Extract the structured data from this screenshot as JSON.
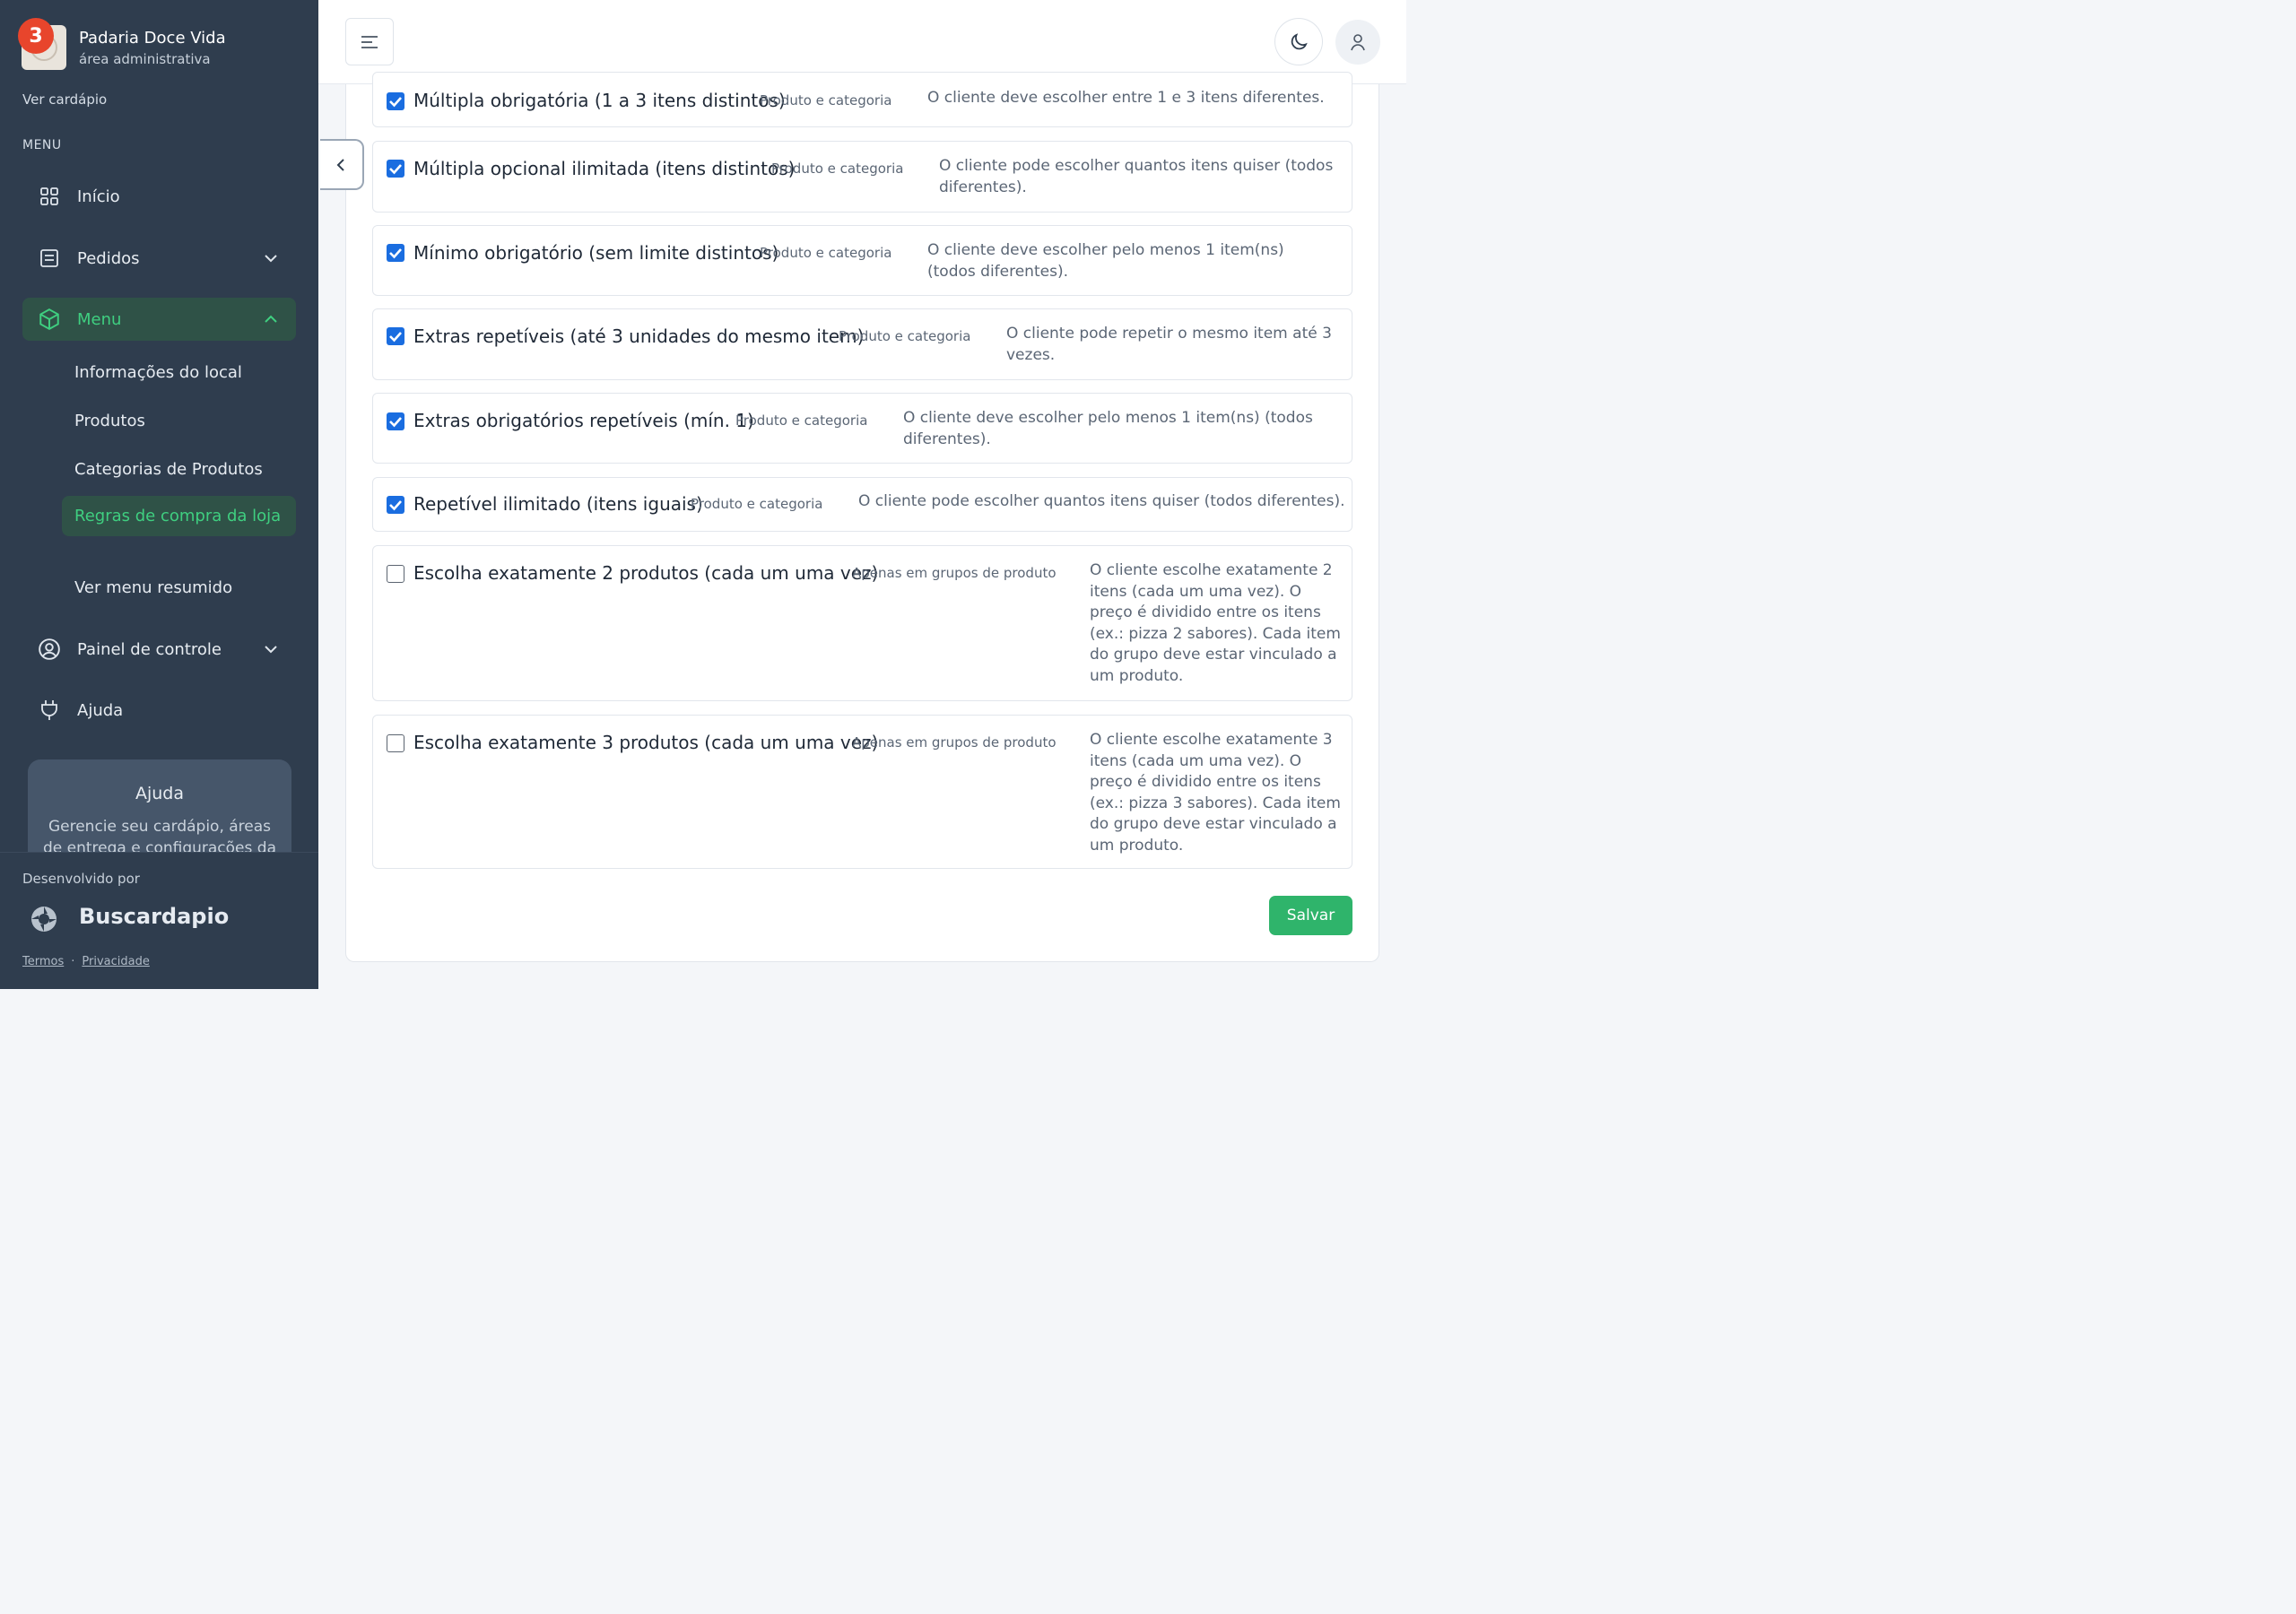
{
  "brand": {
    "name": "Padaria Doce Vida",
    "subtitle": "área administrativa",
    "notification_count": "3"
  },
  "sidebar": {
    "view_menu_link": "Ver cardápio",
    "menu_header": "MENU",
    "items": [
      {
        "label": "Início",
        "icon": "grid-icon"
      },
      {
        "label": "Pedidos",
        "icon": "receipt-icon"
      },
      {
        "label": "Menu",
        "icon": "box-icon"
      },
      {
        "label": "Painel de controle",
        "icon": "user-circle-icon"
      },
      {
        "label": "Ajuda",
        "icon": "plug-icon"
      }
    ],
    "subitems": [
      {
        "label": "Informações do local"
      },
      {
        "label": "Produtos"
      },
      {
        "label": "Categorias de Produtos"
      },
      {
        "label": "Regras de compra da loja"
      },
      {
        "label": "Ver menu resumido"
      }
    ],
    "help_card": {
      "title": "Ajuda",
      "text": "Gerencie seu cardápio, áreas de entrega e configurações da"
    },
    "developed_by": "Desenvolvido por",
    "developer_name": "Buscardapio",
    "footer": {
      "terms": "Termos",
      "separator": "·",
      "privacy": "Privacidade"
    }
  },
  "rules": [
    {
      "title": "Múltipla obrigatória (1 a 3 itens distintos)",
      "scope": "Produto e categoria",
      "description": "O cliente deve escolher entre 1 e 3 itens diferentes.",
      "checked": true
    },
    {
      "title": "Múltipla opcional ilimitada (itens distintos)",
      "scope": "Produto e categoria",
      "description": "O cliente pode escolher quantos itens quiser (todos diferentes).",
      "checked": true
    },
    {
      "title": "Mínimo obrigatório (sem limite distintos)",
      "scope": "Produto e categoria",
      "description": "O cliente deve escolher pelo menos 1 item(ns) (todos diferentes).",
      "checked": true
    },
    {
      "title": "Extras repetíveis (até 3 unidades do mesmo item)",
      "scope": "Produto e categoria",
      "description": "O cliente pode repetir o mesmo item até 3 vezes.",
      "checked": true
    },
    {
      "title": "Extras obrigatórios repetíveis (mín. 1)",
      "scope": "Produto e categoria",
      "description": "O cliente deve escolher pelo menos 1 item(ns) (todos diferentes).",
      "checked": true
    },
    {
      "title": "Repetível ilimitado (itens iguais)",
      "scope": "Produto e categoria",
      "description": "O cliente pode escolher quantos itens quiser (todos diferentes).",
      "checked": true
    },
    {
      "title": "Escolha exatamente 2 produtos (cada um uma vez)",
      "scope": "Apenas em grupos de produto",
      "description": "O cliente escolhe exatamente 2 itens (cada um uma vez). O preço é dividido entre os itens (ex.: pizza 2 sabores). Cada item do grupo deve estar vinculado a um produto.",
      "checked": false
    },
    {
      "title": "Escolha exatamente 3 produtos (cada um uma vez)",
      "scope": "Apenas em grupos de produto",
      "description": "O cliente escolhe exatamente 3 itens (cada um uma vez). O preço é dividido entre os itens (ex.: pizza 3 sabores). Cada item do grupo deve estar vinculado a um produto.",
      "checked": false
    }
  ],
  "actions": {
    "save_label": "Salvar"
  },
  "colors": {
    "sidebar_bg": "#2f3d4e",
    "accent_green": "#3fcf80",
    "save_green": "#2fb46b",
    "checkbox_blue": "#1a6de0",
    "badge_red": "#e8452c"
  }
}
